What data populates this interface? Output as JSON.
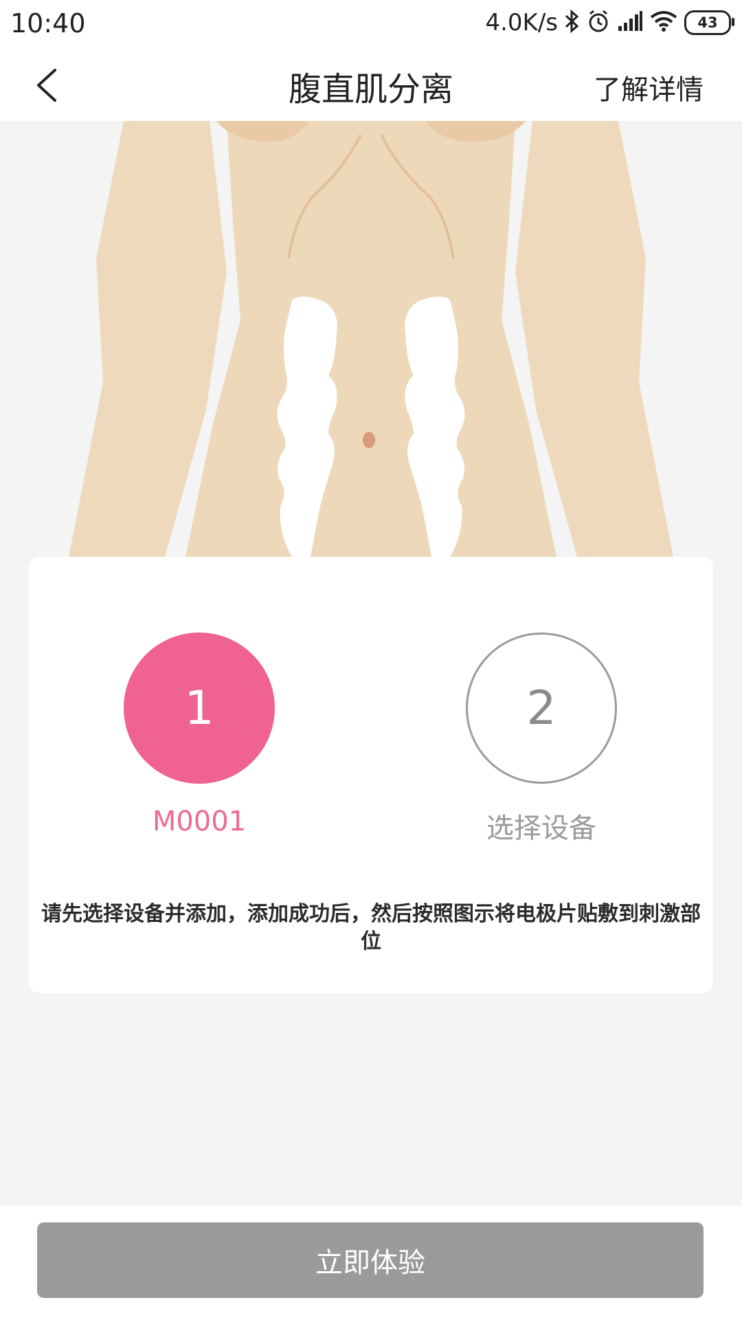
{
  "status_bar": {
    "time": "10:40",
    "network_speed": "4.0K/s",
    "battery_level": "43",
    "icons": [
      "bluetooth-icon",
      "alarm-icon",
      "signal-icon",
      "wifi-icon",
      "battery-icon"
    ]
  },
  "header": {
    "title": "腹直肌分离",
    "detail_link": "了解详情"
  },
  "steps": [
    {
      "number": "1",
      "label": "M0001",
      "state": "active",
      "color": "#f06292"
    },
    {
      "number": "2",
      "label": "选择设备",
      "state": "inactive",
      "color": "#9a9a9a"
    }
  ],
  "instruction": "请先选择设备并添加，添加成功后，然后按照图示将电极片贴敷到刺激部位",
  "bottom_button": {
    "label": "立即体验",
    "color": "#9a9a9a"
  },
  "colors": {
    "accent": "#f06292",
    "skin": "#efd9bd",
    "background": "#f3f4f3"
  }
}
